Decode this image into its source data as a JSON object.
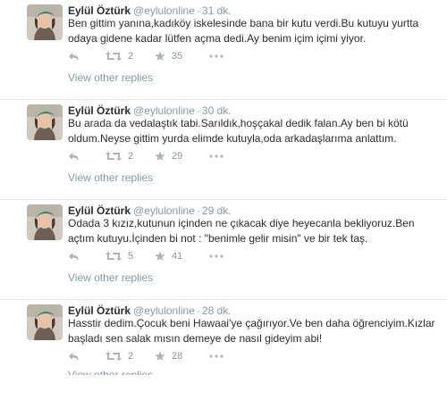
{
  "tweets": [
    {
      "name": "Eylül Öztürk",
      "handle": "@eylulonline",
      "separator": "·",
      "time": "31 dk.",
      "text": "Ben gittim yanına,kadıköy iskelesinde bana bir kutu verdi.Bu kutuyu yurtta odaya gidene kadar lütfen açma dedi.Ay benim içim içimi yiyor.",
      "retweets": "2",
      "likes": "35",
      "view_replies": "View other replies"
    },
    {
      "name": "Eylül Öztürk",
      "handle": "@eylulonline",
      "separator": "·",
      "time": "30 dk.",
      "text": "Bu arada da vedalaştık tabi.Sarıldık,hoşçakal dedik falan.Ay ben bi kötü oldum.Neyse gittim yurda elimde kutuyla,oda arkadaşlarıma anlattım.",
      "retweets": "2",
      "likes": "29",
      "view_replies": "View other replies"
    },
    {
      "name": "Eylül Öztürk",
      "handle": "@eylulonline",
      "separator": "·",
      "time": "29 dk.",
      "text": "Odada 3 kızız,kutunun içinden ne çıkacak diye heyecanla bekliyoruz.Ben açtım kutuyu.İçinden bi not : \"benimle gelir misin\" ve bir tek taş.",
      "retweets": "5",
      "likes": "41",
      "view_replies": "View other replies"
    },
    {
      "name": "Eylül Öztürk",
      "handle": "@eylulonline",
      "separator": "·",
      "time": "28 dk.",
      "text": "Hasstir dedim.Çocuk beni Hawaai'ye çağırıyor.Ve ben daha öğrenciyim.Kızlar başladı sen salak mısın demeye de nasıl gideyim abi!",
      "retweets": "2",
      "likes": "28",
      "view_replies": "View other replies"
    }
  ],
  "icons": {
    "reply": "reply-icon",
    "retweet": "retweet-icon",
    "like": "star-icon",
    "more": "more-dots-icon"
  },
  "colors": {
    "text": "#292f33",
    "muted": "#8899a6",
    "divider": "#e1e8ed"
  }
}
